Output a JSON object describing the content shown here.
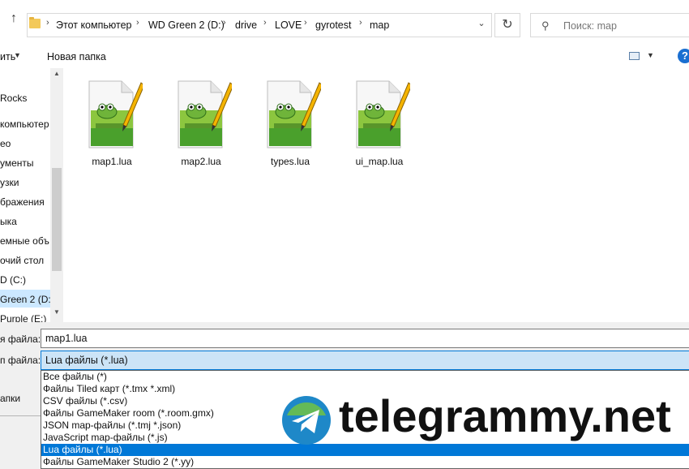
{
  "address": {
    "crumbs": [
      "Этот компьютер",
      "WD Green 2 (D:)",
      "drive",
      "LOVE",
      "gyrotest",
      "map"
    ],
    "search_placeholder": "Поиск: map"
  },
  "toolbar": {
    "organize_label": "ить",
    "new_folder_label": "Новая папка"
  },
  "nav": {
    "items": [
      "Rocks",
      "компьютер",
      "ео",
      "ументы",
      "узки",
      "бражения",
      "ыка",
      "емные объ",
      "очий стол",
      "D (C:)",
      "Green 2 (D:)",
      "Purple (E:)"
    ],
    "selected_index": 10
  },
  "files": [
    {
      "name": "map1.lua",
      "icon": "notepadpp-file-icon"
    },
    {
      "name": "map2.lua",
      "icon": "notepadpp-file-icon"
    },
    {
      "name": "types.lua",
      "icon": "notepadpp-file-icon"
    },
    {
      "name": "ui_map.lua",
      "icon": "notepadpp-file-icon"
    }
  ],
  "form": {
    "filename_label": "я файла:",
    "filename_value": "map1.lua",
    "filetype_label": "п файла:",
    "filetype_value": "Lua файлы (*.lua)",
    "hide_folders_label": "апки"
  },
  "filetype_options": [
    "Все файлы (*)",
    "Файлы Tiled карт (*.tmx *.xml)",
    "CSV файлы (*.csv)",
    "Файлы GameMaker room (*.room.gmx)",
    "JSON map-файлы (*.tmj *.json)",
    "JavaScript map-файлы (*.js)",
    "Lua файлы (*.lua)",
    "Файлы GameMaker Studio 2 (*.yy)"
  ],
  "filetype_selected_index": 6,
  "watermark": {
    "text": "telegrammy.net"
  },
  "colors": {
    "selection": "#0078d7",
    "nav_selected": "#cce8ff",
    "combo_bg": "#cce4f7"
  }
}
